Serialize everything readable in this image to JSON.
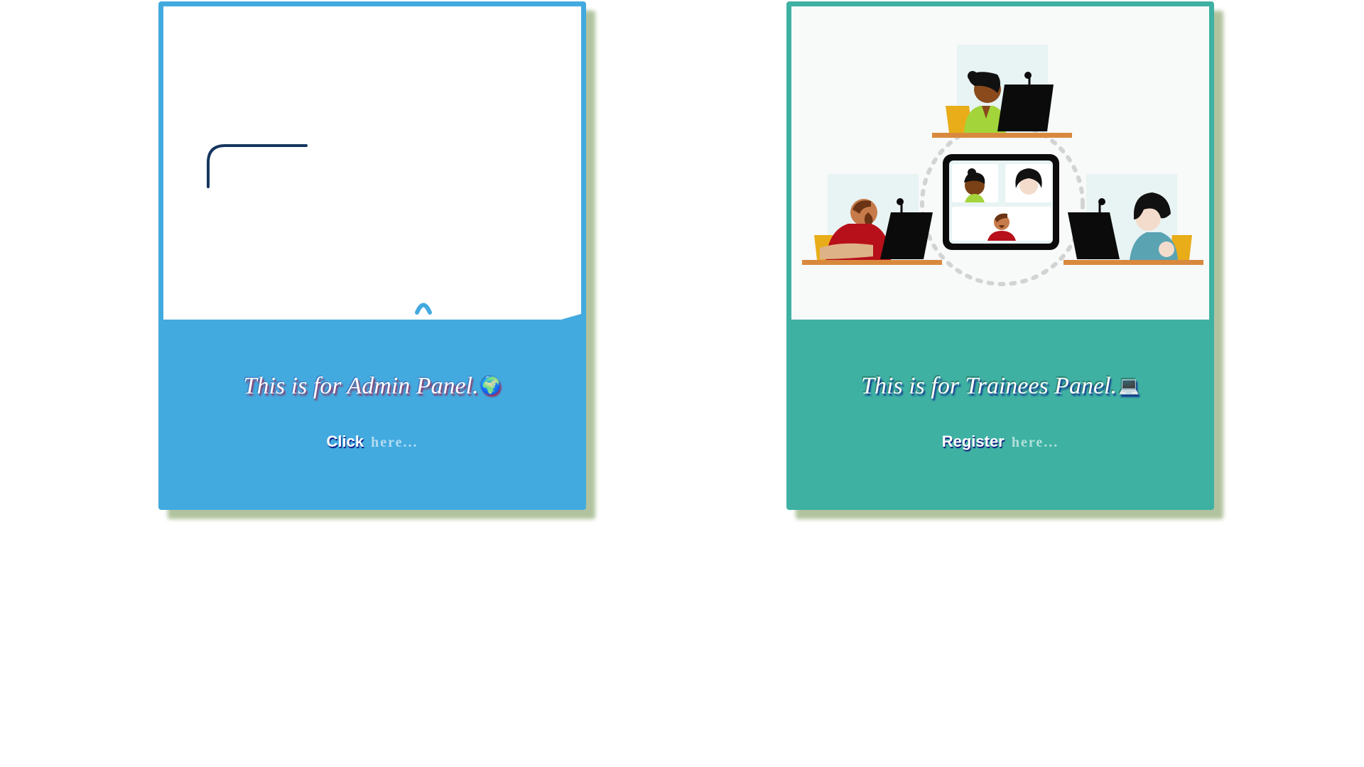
{
  "cards": [
    {
      "title": "This is for Admin Panel.",
      "emoji": "🌍",
      "link_action": "Click",
      "link_here": "here..."
    },
    {
      "title": "This is for Trainees Panel.",
      "emoji": "💻",
      "link_action": "Register",
      "link_here": "here..."
    }
  ],
  "colors": {
    "admin_accent": "#42aadf",
    "trainee_accent": "#3eb1a3",
    "shadow": "#96af7d"
  }
}
